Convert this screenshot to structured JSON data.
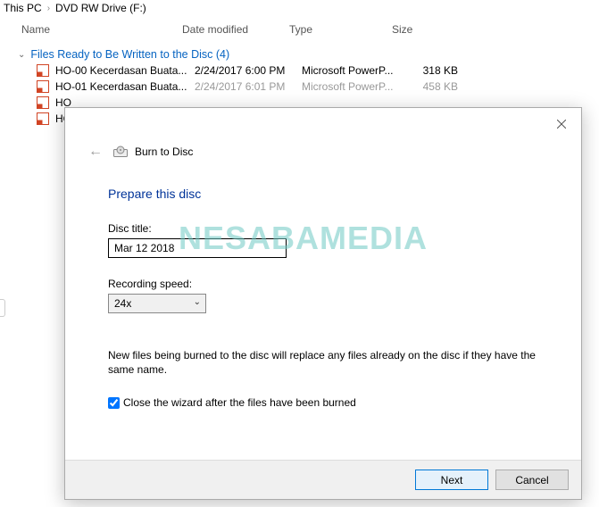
{
  "breadcrumb": {
    "thispc": "This PC",
    "drive": "DVD RW Drive (F:)"
  },
  "columns": {
    "name": "Name",
    "date": "Date modified",
    "type": "Type",
    "size": "Size"
  },
  "group_label": "Files Ready to Be Written to the Disc (4)",
  "files": [
    {
      "name": "HO-00 Kecerdasan Buata...",
      "date": "2/24/2017 6:00 PM",
      "type": "Microsoft PowerP...",
      "size": "318 KB"
    },
    {
      "name": "HO-01 Kecerdasan Buata...",
      "date": "2/24/2017 6:01 PM",
      "type": "Microsoft PowerP...",
      "size": "458 KB"
    },
    {
      "name": "HO",
      "date": "",
      "type": "",
      "size": ""
    },
    {
      "name": "HO",
      "date": "",
      "type": "",
      "size": ""
    }
  ],
  "dialog": {
    "title": "Burn to Disc",
    "heading": "Prepare this disc",
    "disc_title_label": "Disc title:",
    "disc_title_value": "Mar 12 2018",
    "speed_label": "Recording speed:",
    "speed_value": "24x",
    "note": "New files being burned to the disc will replace any files already on the disc if they have the same name.",
    "close_checkbox_label": "Close the wizard after the files have been burned",
    "close_checkbox_checked": true,
    "next": "Next",
    "cancel": "Cancel"
  },
  "watermark": "NESABAMEDIA"
}
